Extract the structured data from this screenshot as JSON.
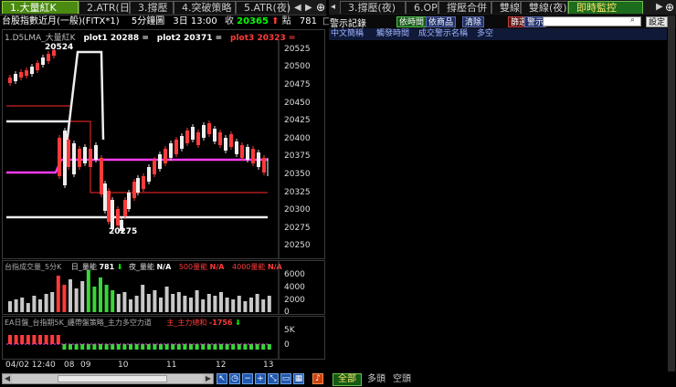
{
  "left_tabs": [
    "1.大量紅K",
    "2.ATR(日)",
    "3.撐壓",
    "4.突破策略",
    "5.ATR(夜)"
  ],
  "right_tabs": [
    "3.撐壓(夜)",
    "6.OP",
    "撐壓合併",
    "雙線",
    "雙線(夜)",
    "即時監控"
  ],
  "symbol_bar": {
    "name": "台股指數近月(一般)(FITX*1)",
    "period": "5分鐘圖",
    "date": "3日 13:00",
    "close_label": "收",
    "close": "20365",
    "change_label": "點",
    "change": "781",
    "bullet": "□"
  },
  "price_chart": {
    "legend_name": "1.D5LMA_大量紅K",
    "plot1": "plot1 20288 =",
    "plot2": "plot2 20371 =",
    "plot3": "plot3 20323 =",
    "y_ticks": [
      "20525",
      "20500",
      "20475",
      "20450",
      "20425",
      "20400",
      "20375",
      "20350",
      "20325",
      "20300",
      "20275",
      "20250"
    ],
    "high_label": "20524",
    "low_label": "20275"
  },
  "volume_chart": {
    "name": "台指成交量_5分K",
    "day_label": "日_量能",
    "day_value": "781",
    "night_label": "夜_量能",
    "night_value": "N/A",
    "l500": "500量能",
    "l500_v": "N/A",
    "l4000": "4000量能",
    "l4000_v": "N/A",
    "y_ticks": [
      "6000",
      "4000",
      "2000",
      "0"
    ]
  },
  "strategy_chart": {
    "name": "EA日盤_台指期5K_纏帶盤策略_主力多空力道",
    "force_label": "主_主力總和",
    "force_value": "-1756",
    "y_ticks": [
      "5K",
      "0"
    ]
  },
  "x_axis": [
    "04/02 12:40",
    "08",
    "09",
    "10",
    "11",
    "12",
    "13"
  ],
  "alerts": {
    "title": "警示記錄",
    "btn_time": "依時間",
    "btn_product": "依商品",
    "btn_clear": "清除",
    "btn_filter": "篩選",
    "btn_alert": "警示",
    "btn_settings": "設定",
    "columns": [
      "中文簡稱",
      "觸發時間",
      "成交警示名稱",
      "多空"
    ]
  },
  "bottom_tabs": [
    "全部",
    "多頭",
    "空頭"
  ],
  "colors": {
    "active_tab": "#4a8a10",
    "close": "#00ff00",
    "up": "#ff3a3a",
    "pink": "#ff3cf0"
  }
}
